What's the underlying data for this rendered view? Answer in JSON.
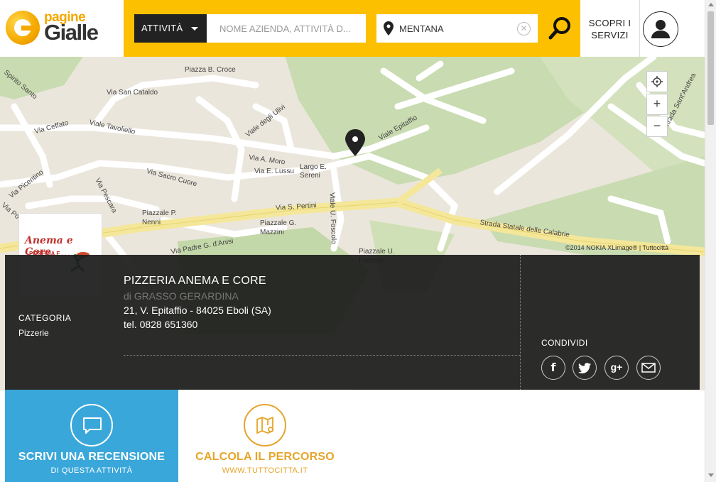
{
  "header": {
    "logo_small": "pagine",
    "logo_big": "Gialle",
    "category_select": "ATTIVITÀ",
    "what_placeholder": "NOME AZIENDA, ATTIVITÀ D...",
    "where_value": "MENTANA",
    "discover_line1": "SCOPRI I",
    "discover_line2": "SERVIZI",
    "icons": {
      "pin": "map-pin-icon",
      "clear": "clear-icon",
      "search": "search-icon",
      "user": "user-icon"
    },
    "colors": {
      "brand_yellow": "#fcc000",
      "dark": "#222222"
    }
  },
  "map": {
    "labels": [
      "Piazza B. Croce",
      "Via San Cataldo",
      "Spirito Santo",
      "Via Ceffato",
      "Viale Tavoliello",
      "Viale degli Ulivi",
      "Viale Epitaffio",
      "Via A. Moro",
      "Via E. Lussu",
      "Largo E. Sereni",
      "Via Sacro Cuore",
      "Via Picentino",
      "Via Pescara",
      "Via S. Pertini",
      "Viale U. Foscolo",
      "Piazzale P. Nenni",
      "Piazzale G. Mazzini",
      "Via Padre G. d'Anisi",
      "Piazzale U. Foscolo",
      "Strada Statale delle Calabrie",
      "Contrada Sant'Andrea",
      "Via Po"
    ],
    "zoom_in": "+",
    "zoom_out": "−",
    "attribution": "©2014 NOKIA XLimage® | Tuttocittà"
  },
  "business": {
    "name": "PIZZERIA ANEMA E CORE",
    "owner": "di GRASSO GERARDINA",
    "address": "21, V. Epitaffio - 84025 Eboli (SA)",
    "phone": "tel. 0828 651360",
    "category_label": "CATEGORIA",
    "category_value": "Pizzerie",
    "logo_title": "Anema e Core",
    "logo_sub": "PIZZERIA E . . ."
  },
  "share": {
    "label": "CONDIVIDI",
    "networks": [
      "facebook-icon",
      "twitter-icon",
      "googleplus-icon",
      "email-icon"
    ]
  },
  "actions": {
    "review_title": "SCRIVI UNA RECENSIONE",
    "review_sub": "DI QUESTA ATTIVITÀ",
    "route_title": "CALCOLA IL PERCORSO",
    "route_sub": "WWW.TUTTOCITTA.IT",
    "review_color": "#3aa7da",
    "route_color": "#e5a52a"
  }
}
